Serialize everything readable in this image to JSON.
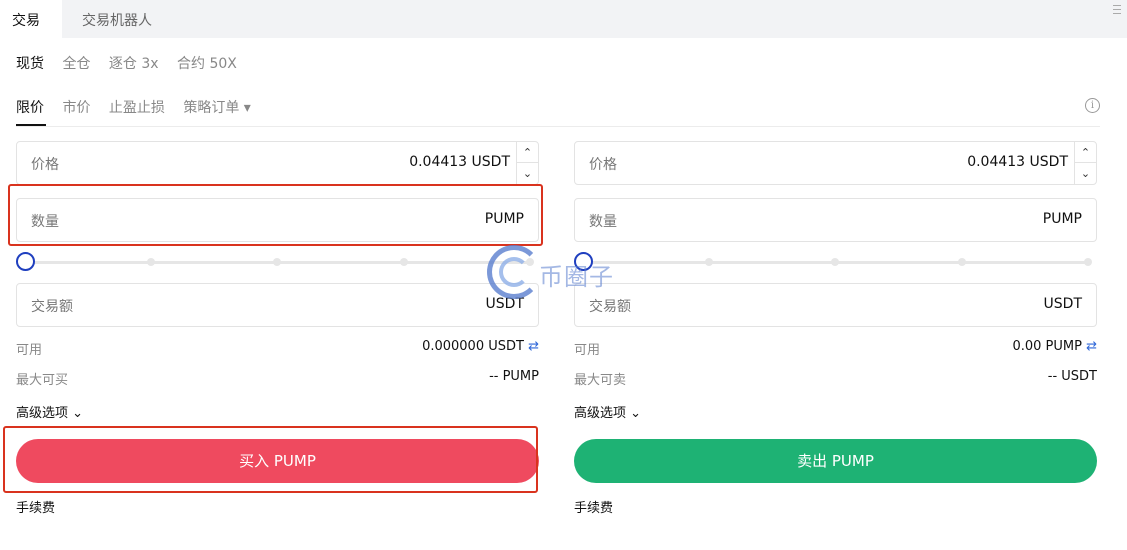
{
  "top_tabs": {
    "trade": "交易",
    "bot": "交易机器人"
  },
  "mode_tabs": [
    "现货",
    "全仓",
    "逐仓 3x",
    "合约 50X"
  ],
  "order_tabs": [
    "限价",
    "市价",
    "止盈止损",
    "策略订单 ▾"
  ],
  "buy": {
    "price_label": "价格",
    "price_value": "0.04413 USDT",
    "amount_label": "数量",
    "amount_unit": "PUMP",
    "total_label": "交易额",
    "total_unit": "USDT",
    "available_label": "可用",
    "available_value": "0.000000 USDT",
    "max_label": "最大可买",
    "max_value": "-- PUMP",
    "advanced_label": "高级选项",
    "button_label": "买入 PUMP",
    "fee_label": "手续费"
  },
  "sell": {
    "price_label": "价格",
    "price_value": "0.04413 USDT",
    "amount_label": "数量",
    "amount_unit": "PUMP",
    "total_label": "交易额",
    "total_unit": "USDT",
    "available_label": "可用",
    "available_value": "0.00 PUMP",
    "max_label": "最大可卖",
    "max_value": "-- USDT",
    "advanced_label": "高级选项",
    "button_label": "卖出 PUMP",
    "fee_label": "手续费"
  },
  "watermark_text": "币圈子",
  "icons": {
    "info": "info-icon",
    "swap": "swap-icon",
    "chevron": "chevron-down-icon",
    "menu": "menu-icon"
  },
  "colors": {
    "buy": "#ef4a5f",
    "sell": "#1eb274",
    "annotation": "#d9331e",
    "link": "#2f67d8"
  }
}
